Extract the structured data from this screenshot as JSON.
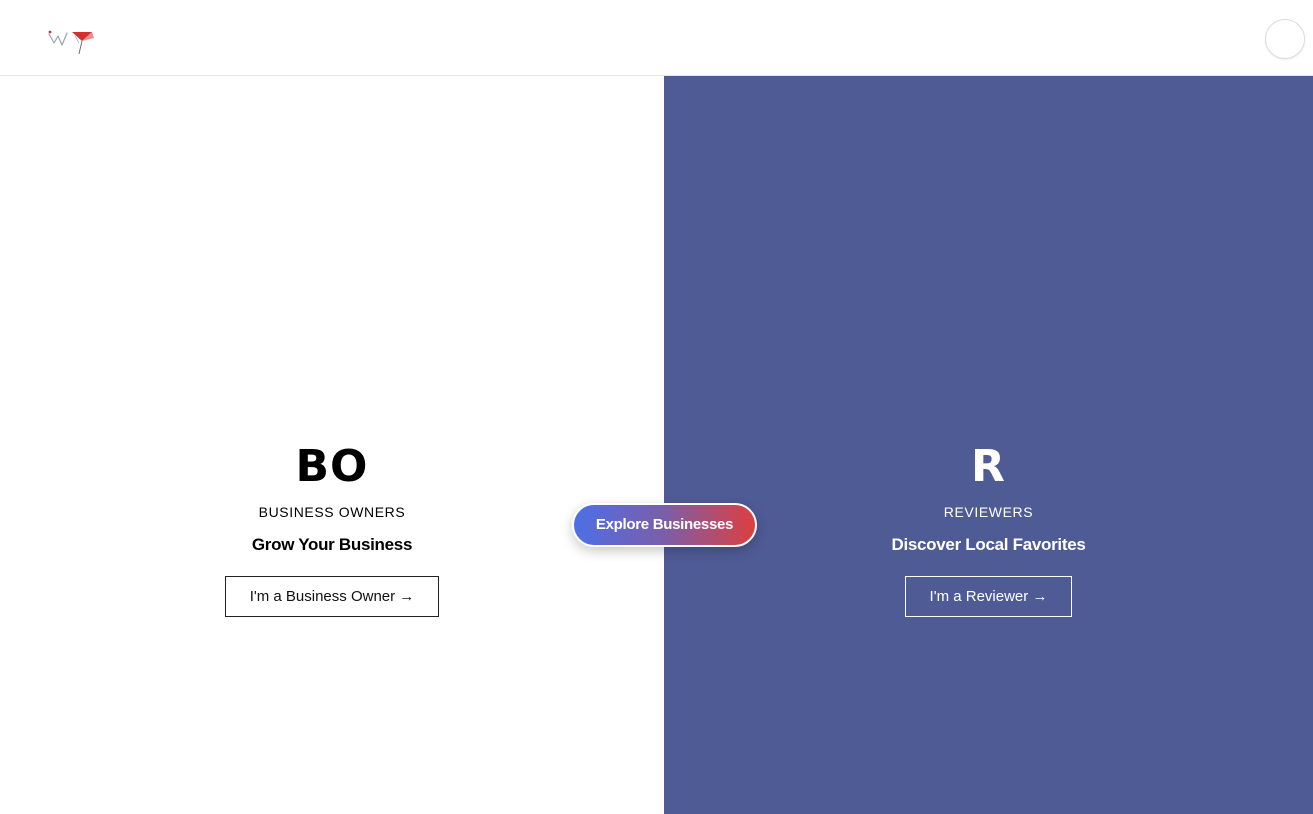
{
  "header": {
    "logo_icon": "wp-logo-icon",
    "menu_icon": "profile-circle-icon"
  },
  "business": {
    "initials": "BO",
    "role": "BUSINESS OWNERS",
    "tagline": "Grow Your Business",
    "cta_label": "I'm a Business Owner →"
  },
  "reviewer": {
    "initials": "R",
    "role": "REVIEWERS",
    "tagline": "Discover Local Favorites",
    "cta_label": "I'm a Reviewer →"
  },
  "explore": {
    "label": "Explore Businesses"
  },
  "colors": {
    "right_panel": "#4f5b95",
    "explore_gradient_start": "#4d6fe6",
    "explore_gradient_end": "#dd3f3f"
  }
}
